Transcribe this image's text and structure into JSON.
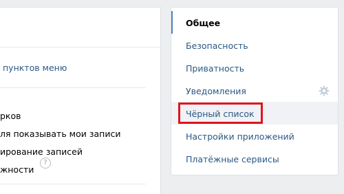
{
  "main": {
    "menu_link": "пунктов меню",
    "options": [
      "рков",
      "ля показывать мои записи",
      "ирование записей",
      "жности"
    ],
    "help_glyph": "?"
  },
  "settings_menu": {
    "items": [
      {
        "label": "Общее"
      },
      {
        "label": "Безопасность"
      },
      {
        "label": "Приватность"
      },
      {
        "label": "Уведомления"
      },
      {
        "label": "Чёрный список"
      },
      {
        "label": "Настройки приложений"
      },
      {
        "label": "Платёжные сервисы"
      }
    ],
    "active_index": 0,
    "hover_index": 4
  },
  "colors": {
    "accent": "#5181b8",
    "link": "#2a5885",
    "highlight": "#e0141e"
  }
}
